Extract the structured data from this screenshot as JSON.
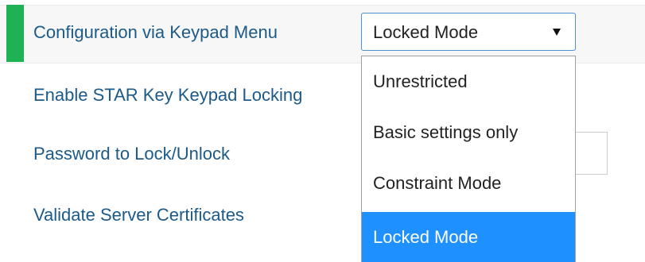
{
  "colors": {
    "accent": "#1fb255",
    "label": "#1c5a8a",
    "selected_option_bg": "#1e90ff"
  },
  "settings": {
    "rows": [
      {
        "label": "Configuration via Keypad Menu"
      },
      {
        "label": "Enable STAR Key Keypad Locking"
      },
      {
        "label": "Password to Lock/Unlock"
      },
      {
        "label": "Validate Server Certificates"
      }
    ]
  },
  "keypad_menu_select": {
    "value": "Locked Mode",
    "options": [
      {
        "label": "Unrestricted",
        "selected": false
      },
      {
        "label": "Basic settings only",
        "selected": false
      },
      {
        "label": "Constraint Mode",
        "selected": false
      },
      {
        "label": "Locked Mode",
        "selected": true
      }
    ]
  }
}
